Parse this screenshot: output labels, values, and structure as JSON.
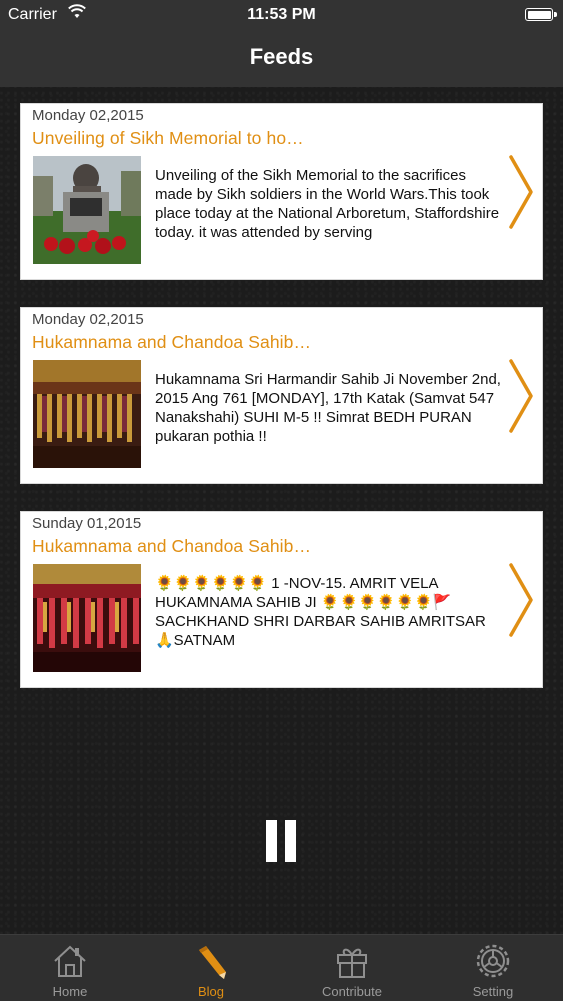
{
  "status_bar": {
    "carrier": "Carrier",
    "time": "11:53 PM"
  },
  "header": {
    "title": "Feeds"
  },
  "feeds": [
    {
      "date": "Monday 02,2015",
      "title": "Unveiling of Sikh Memorial to ho…",
      "summary": "Unveiling of the Sikh Memorial to the sacrifices made by Sikh soldiers in the World Wars.This took place today at the National Arboretum, Staffordshire today. it was attended by serving"
    },
    {
      "date": "Monday 02,2015",
      "title": "Hukamnama and Chandoa Sahib…",
      "summary": "Hukamnama Sri Harmandir Sahib Ji November 2nd, 2015 Ang 761 [MONDAY], 17th Katak (Samvat 547 Nanakshahi) SUHI M-5 !! Simrat BEDH PURAN pukaran pothia !!"
    },
    {
      "date": "Sunday 01,2015",
      "title": "Hukamnama and Chandoa Sahib…",
      "summary": "🌻🌻🌻🌻🌻🌻 1 -NOV-15. AMRIT VELA HUKAMNAMA SAHIB JI 🌻🌻🌻🌻🌻🌻🚩 SACHKHAND SHRI DARBAR SAHIB AMRITSAR 🙏SATNAM"
    }
  ],
  "tab_bar": {
    "tabs": [
      {
        "label": "Home",
        "icon": "home-icon"
      },
      {
        "label": "Blog",
        "icon": "pencil-icon"
      },
      {
        "label": "Contribute",
        "icon": "gift-icon"
      },
      {
        "label": "Setting",
        "icon": "gear-icon"
      }
    ],
    "active": "Blog"
  },
  "colors": {
    "accent": "#e08f14",
    "nav_bg": "#333333",
    "tab_bg": "#2f2f2f"
  }
}
